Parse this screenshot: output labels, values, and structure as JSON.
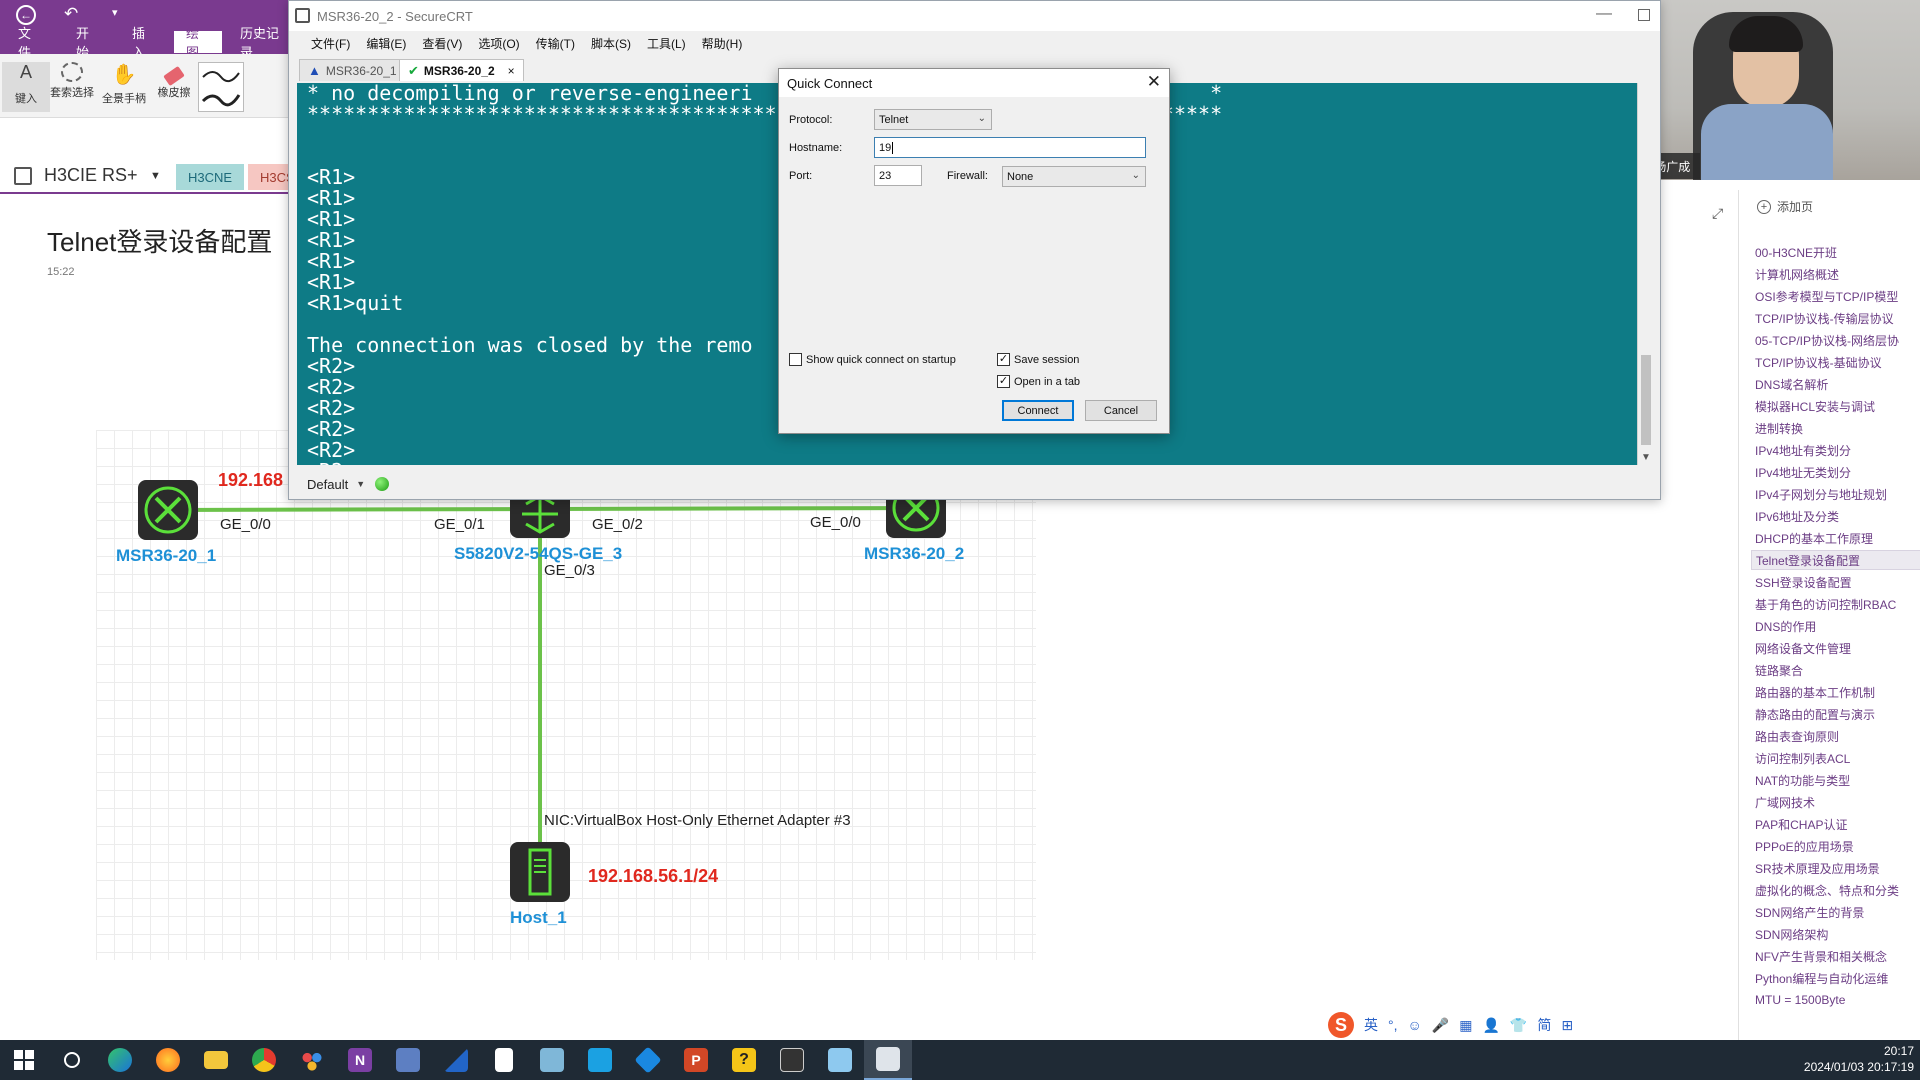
{
  "onenote": {
    "menus": [
      "文件",
      "开始",
      "插入",
      "绘图",
      "历史记录"
    ],
    "active_menu": "绘图",
    "ribbon": [
      "键入",
      "套索选择",
      "全景手柄",
      "橡皮擦"
    ],
    "notebook_name": "H3CIE RS+",
    "section_tabs": [
      "H3CNE",
      "H3CS"
    ],
    "page_title": "Telnet登录设备配置",
    "page_time": "15:22"
  },
  "topology": {
    "nodes": {
      "r1": "MSR36-20_1",
      "sw": "S5820V2-54QS-GE_3",
      "r2": "MSR36-20_2",
      "host": "Host_1"
    },
    "interfaces": {
      "r1_ge0": "GE_0/0",
      "sw_ge1": "GE_0/1",
      "sw_ge2": "GE_0/2",
      "r2_ge0": "GE_0/0",
      "sw_ge3": "GE_0/3"
    },
    "nic_label": "NIC:VirtualBox Host-Only Ethernet Adapter #3",
    "ip_top": "192.168",
    "ip_host": "192.168.56.1/24"
  },
  "right_panel": {
    "add_page": "添加页",
    "pages": [
      "00-H3CNE开班",
      "计算机网络概述",
      "OSI参考模型与TCP/IP模型",
      "TCP/IP协议栈-传输层协议",
      "05-TCP/IP协议栈-网络层协",
      "TCP/IP协议栈-基础协议",
      "DNS域名解析",
      "模拟器HCL安装与调试",
      "进制转换",
      "IPv4地址有类划分",
      "IPv4地址无类划分",
      "IPv4子网划分与地址规划",
      "IPv6地址及分类",
      "DHCP的基本工作原理",
      "Telnet登录设备配置",
      "SSH登录设备配置",
      "基于角色的访问控制RBAC",
      "DNS的作用",
      "网络设备文件管理",
      "链路聚合",
      "路由器的基本工作机制",
      "静态路由的配置与演示",
      "路由表查询原则",
      "访问控制列表ACL",
      "NAT的功能与类型",
      "广域网技术",
      "PAP和CHAP认证",
      "PPPoE的应用场景",
      "SR技术原理及应用场景",
      "虚拟化的概念、特点和分类",
      "SDN网络产生的背景",
      "SDN网络架构",
      "NFV产生背景和相关概念",
      "Python编程与自动化运维",
      "MTU = 1500Byte"
    ],
    "selected_index": 14
  },
  "webcam": {
    "name": "杨广成"
  },
  "securecrt": {
    "title": "MSR36-20_2 - SecureCRT",
    "menus": [
      "文件(F)",
      "编辑(E)",
      "查看(V)",
      "选项(O)",
      "传输(T)",
      "脚本(S)",
      "工具(L)",
      "帮助(H)"
    ],
    "tabs": [
      "MSR36-20_1",
      "MSR36-20_2"
    ],
    "active_tab": "MSR36-20_2",
    "terminal_lines": [
      "* no decompiling or reverse-engineeri                                      *",
      "****************************************************************************",
      "",
      "",
      "<R1>",
      "<R1>",
      "<R1>",
      "<R1>",
      "<R1>",
      "<R1>",
      "<R1>quit",
      "",
      "The connection was closed by the remo",
      "<R2>",
      "<R2>",
      "<R2>",
      "<R2>",
      "<R2>",
      "<R2>"
    ],
    "session": "Default"
  },
  "quick_connect": {
    "title": "Quick Connect",
    "protocol_label": "Protocol:",
    "protocol_value": "Telnet",
    "hostname_label": "Hostname:",
    "hostname_value": "19",
    "port_label": "Port:",
    "port_value": "23",
    "firewall_label": "Firewall:",
    "firewall_value": "None",
    "show_on_startup": "Show quick connect on startup",
    "save_session": "Save session",
    "open_in_tab": "Open in a tab",
    "connect": "Connect",
    "cancel": "Cancel"
  },
  "ime": [
    "英",
    "简"
  ],
  "clock": {
    "time": "20:17",
    "datetime": "2024/01/03 20:17:19"
  }
}
